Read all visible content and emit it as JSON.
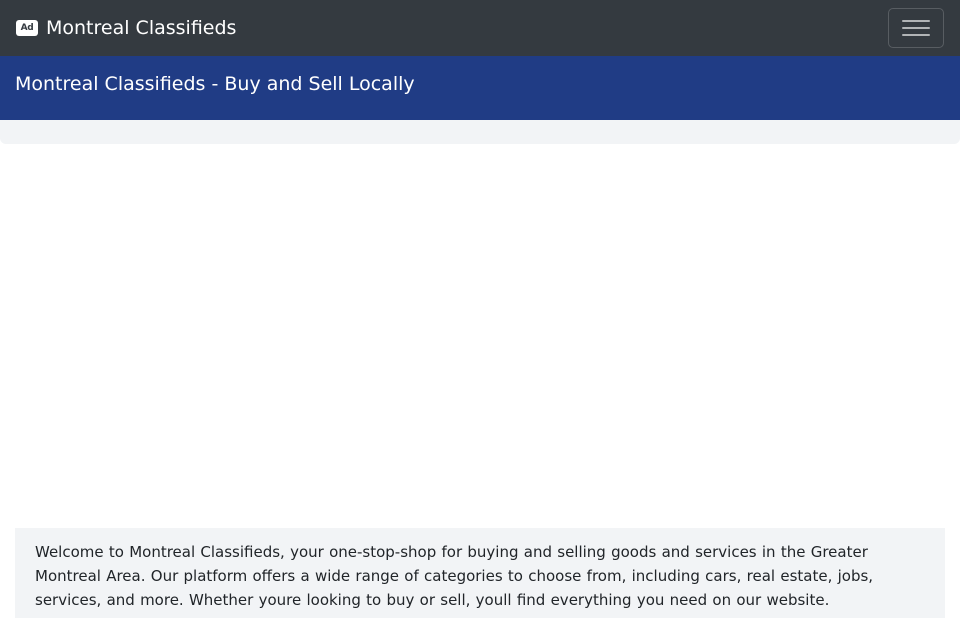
{
  "navbar": {
    "brand_icon_text": "Ad",
    "brand_icon": "ad-icon",
    "brand_text": "Montreal Classifieds",
    "toggler_icon": "hamburger-icon"
  },
  "banner": {
    "title": "Montreal Classifieds - Buy and Sell Locally"
  },
  "intro": {
    "text": "Welcome to Montreal Classifieds, your one-stop-shop for buying and selling goods and services in the Greater Montreal Area. Our platform offers a wide range of categories to choose from, including cars, real estate, jobs, services, and more. Whether youre looking to buy or sell, youll find everything you need on our website."
  },
  "colors": {
    "navbar_bg": "#343a40",
    "banner_bg": "#203c85",
    "panel_bg": "#f2f4f6",
    "text": "#212529"
  }
}
